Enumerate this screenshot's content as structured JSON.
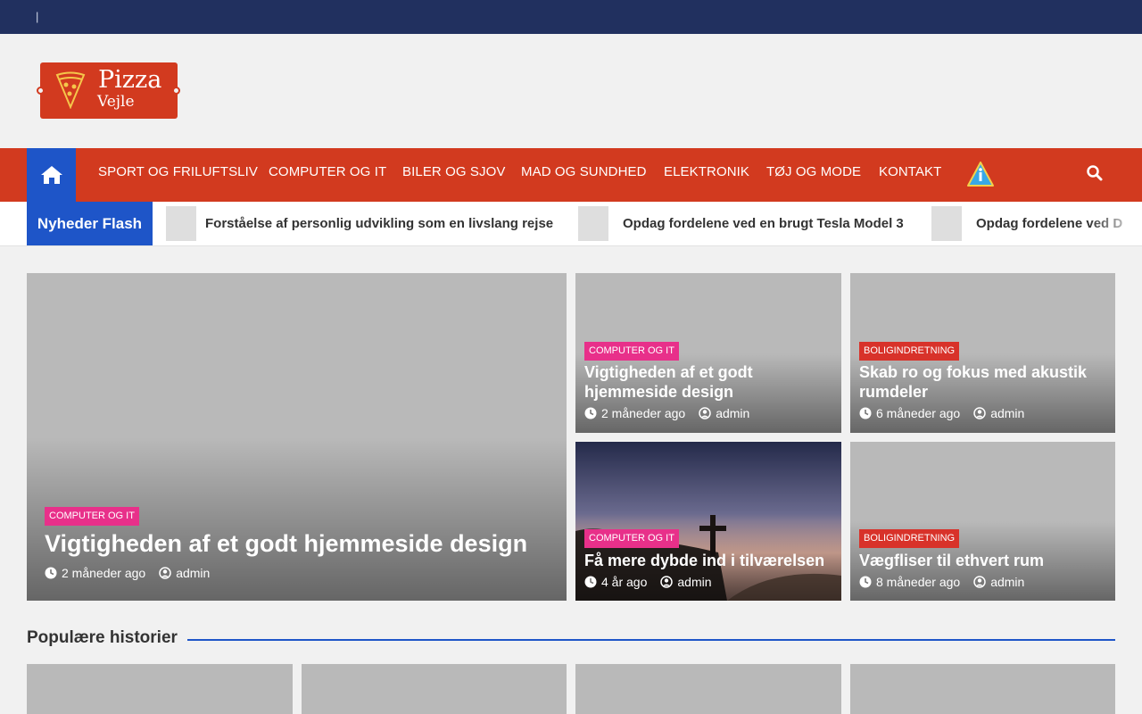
{
  "topbar": {
    "separator": "|"
  },
  "logo": {
    "word1": "Pizza",
    "word2": "Vejle"
  },
  "nav": {
    "items": [
      "SPORT OG FRILUFTSLIV",
      "COMPUTER OG IT",
      "BILER OG SJOV",
      "MAD OG SUNDHED",
      "ELEKTRONIK",
      "TØJ OG MODE",
      "KONTAKT"
    ]
  },
  "flash": {
    "label": "Nyheder Flash",
    "items": [
      "Forståelse af personlig udvikling som en livslang rejse",
      "Opdag fordelene ved en brugt Tesla Model 3",
      "Opdag fordelene ved D"
    ]
  },
  "featured": {
    "main": {
      "tag": "COMPUTER OG IT",
      "title": "Vigtigheden af et godt hjemmeside design",
      "time": "2 måneder ago",
      "author": "admin"
    },
    "cards": [
      {
        "tag": "COMPUTER OG IT",
        "title": "Vigtigheden af et godt hjemmeside design",
        "time": "2 måneder ago",
        "author": "admin"
      },
      {
        "tag": "BOLIGINDRETNING",
        "title": "Skab ro og fokus med akustik rumdeler",
        "time": "6 måneder ago",
        "author": "admin"
      },
      {
        "tag": "COMPUTER OG IT",
        "title": "Få mere dybde ind i tilværelsen",
        "time": "4 år ago",
        "author": "admin"
      },
      {
        "tag": "BOLIGINDRETNING",
        "title": "Vægfliser til ethvert rum",
        "time": "8 måneder ago",
        "author": "admin"
      }
    ]
  },
  "popular": {
    "title": "Populære historier"
  },
  "colors": {
    "accent_red": "#d23a1f",
    "accent_blue": "#1e55c8",
    "topbar": "#21305f",
    "tag_pink": "#e8308a",
    "tag_red": "#d8322a"
  }
}
